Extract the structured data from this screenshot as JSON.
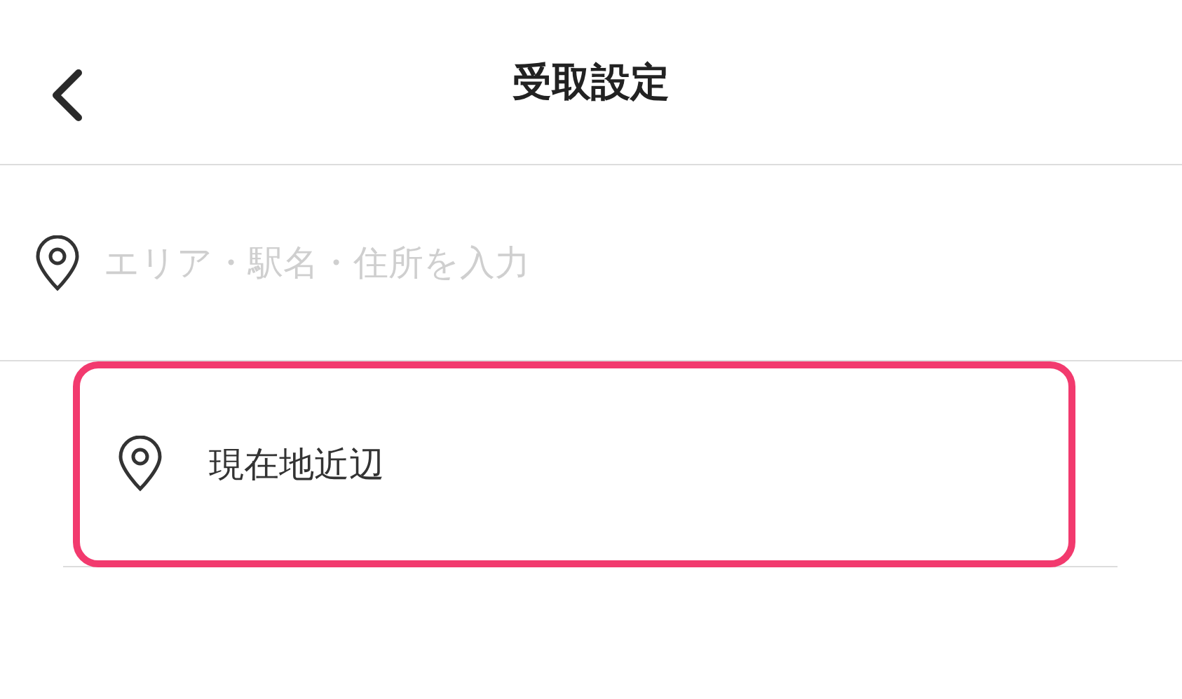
{
  "header": {
    "title": "受取設定"
  },
  "search": {
    "placeholder": "エリア・駅名・住所を入力"
  },
  "suggestions": [
    {
      "label": "現在地近辺",
      "highlighted": true
    }
  ]
}
